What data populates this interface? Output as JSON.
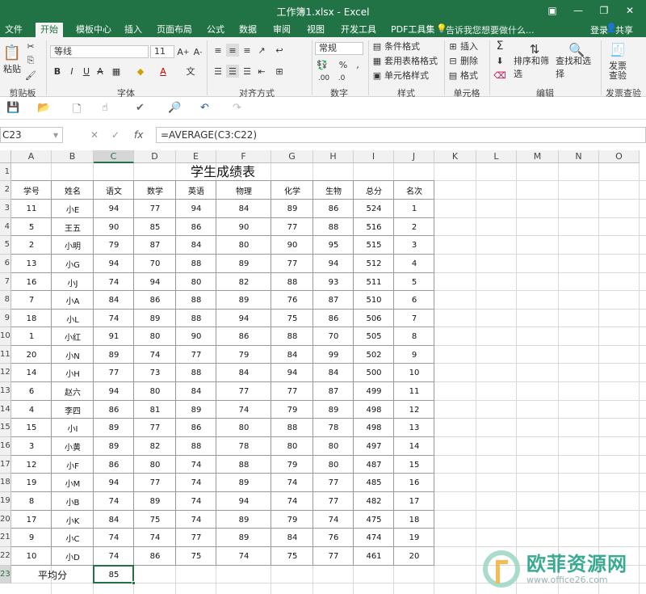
{
  "title": "工作簿1.xlsx - Excel",
  "tabs": [
    "文件",
    "开始",
    "模板中心",
    "插入",
    "页面布局",
    "公式",
    "数据",
    "审阅",
    "视图",
    "开发工具",
    "PDF工具集"
  ],
  "tell_me": "告诉我您想要做什么...",
  "login": "登录",
  "share": "共享",
  "ribbon": {
    "paste": "粘贴",
    "font_name": "等线",
    "font_size": "11",
    "number_format": "常规",
    "cond_format": "条件格式",
    "table_format": "套用表格格式",
    "cell_style": "单元格样式",
    "insert": "插入",
    "delete": "删除",
    "format": "格式",
    "sort_filter": "排序和筛选",
    "find_select": "查找和选择",
    "invoice_check": "发票查验",
    "groups": [
      "剪贴板",
      "字体",
      "对齐方式",
      "数字",
      "样式",
      "单元格",
      "编辑",
      "发票查验"
    ]
  },
  "namebox": "C23",
  "formula": "=AVERAGE(C3:C22)",
  "columns": [
    "A",
    "B",
    "C",
    "D",
    "E",
    "F",
    "G",
    "H",
    "I",
    "J",
    "K",
    "L",
    "M",
    "N",
    "O"
  ],
  "rows": [
    "1",
    "2",
    "3",
    "4",
    "5",
    "6",
    "7",
    "8",
    "9",
    "10",
    "11",
    "12",
    "13",
    "14",
    "15",
    "16",
    "17",
    "18",
    "19",
    "20",
    "21",
    "22",
    "23"
  ],
  "sheet": {
    "title": "学生成绩表",
    "headers": [
      "学号",
      "姓名",
      "语文",
      "数学",
      "英语",
      "物理",
      "化学",
      "生物",
      "总分",
      "名次"
    ],
    "data": [
      [
        "11",
        "小E",
        "94",
        "77",
        "94",
        "84",
        "89",
        "86",
        "524",
        "1"
      ],
      [
        "5",
        "王五",
        "90",
        "85",
        "86",
        "90",
        "77",
        "88",
        "516",
        "2"
      ],
      [
        "2",
        "小明",
        "79",
        "87",
        "84",
        "80",
        "90",
        "95",
        "515",
        "3"
      ],
      [
        "13",
        "小G",
        "94",
        "70",
        "88",
        "89",
        "77",
        "94",
        "512",
        "4"
      ],
      [
        "16",
        "小J",
        "74",
        "94",
        "80",
        "82",
        "88",
        "93",
        "511",
        "5"
      ],
      [
        "7",
        "小A",
        "84",
        "86",
        "88",
        "89",
        "76",
        "87",
        "510",
        "6"
      ],
      [
        "18",
        "小L",
        "74",
        "89",
        "88",
        "94",
        "75",
        "86",
        "506",
        "7"
      ],
      [
        "1",
        "小红",
        "91",
        "80",
        "90",
        "86",
        "88",
        "70",
        "505",
        "8"
      ],
      [
        "20",
        "小N",
        "89",
        "74",
        "77",
        "79",
        "84",
        "99",
        "502",
        "9"
      ],
      [
        "14",
        "小H",
        "77",
        "73",
        "88",
        "84",
        "94",
        "84",
        "500",
        "10"
      ],
      [
        "6",
        "赵六",
        "94",
        "80",
        "84",
        "77",
        "77",
        "87",
        "499",
        "11"
      ],
      [
        "4",
        "李四",
        "86",
        "81",
        "89",
        "74",
        "79",
        "89",
        "498",
        "12"
      ],
      [
        "15",
        "小I",
        "89",
        "77",
        "86",
        "80",
        "88",
        "78",
        "498",
        "13"
      ],
      [
        "3",
        "小黄",
        "89",
        "82",
        "88",
        "78",
        "80",
        "80",
        "497",
        "14"
      ],
      [
        "12",
        "小F",
        "86",
        "80",
        "74",
        "88",
        "79",
        "80",
        "487",
        "15"
      ],
      [
        "19",
        "小M",
        "94",
        "77",
        "74",
        "89",
        "74",
        "77",
        "485",
        "16"
      ],
      [
        "8",
        "小B",
        "74",
        "89",
        "74",
        "94",
        "74",
        "77",
        "482",
        "17"
      ],
      [
        "17",
        "小K",
        "84",
        "75",
        "74",
        "89",
        "79",
        "74",
        "475",
        "18"
      ],
      [
        "9",
        "小C",
        "74",
        "74",
        "77",
        "89",
        "84",
        "76",
        "474",
        "19"
      ],
      [
        "10",
        "小D",
        "74",
        "86",
        "75",
        "74",
        "75",
        "77",
        "461",
        "20"
      ]
    ],
    "avg_label": "平均分",
    "avg_value": "85"
  },
  "watermark": {
    "cn": "欧菲资源网",
    "en": "www.office26.com"
  }
}
